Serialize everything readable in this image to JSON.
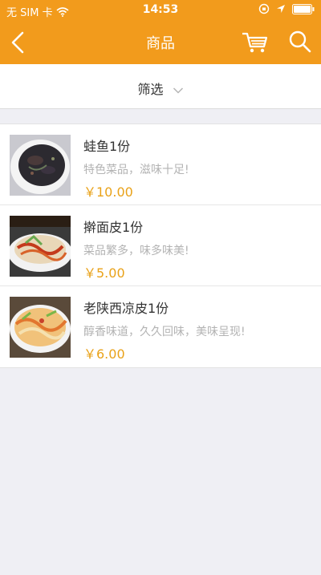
{
  "status_bar": {
    "carrier": "无 SIM 卡",
    "time": "14:53"
  },
  "navbar": {
    "title": "商品"
  },
  "filter": {
    "label": "筛选"
  },
  "products": [
    {
      "name": "蛙鱼1份",
      "description": "特色菜品，滋味十足!",
      "price": "￥10.00"
    },
    {
      "name": "擀面皮1份",
      "description": "菜品繁多，味多味美!",
      "price": "￥5.00"
    },
    {
      "name": "老陕西凉皮1份",
      "description": "醇香味道，久久回味，美味呈现!",
      "price": "￥6.00"
    }
  ],
  "colors": {
    "accent": "#f29b1c",
    "price": "#e9a219"
  }
}
